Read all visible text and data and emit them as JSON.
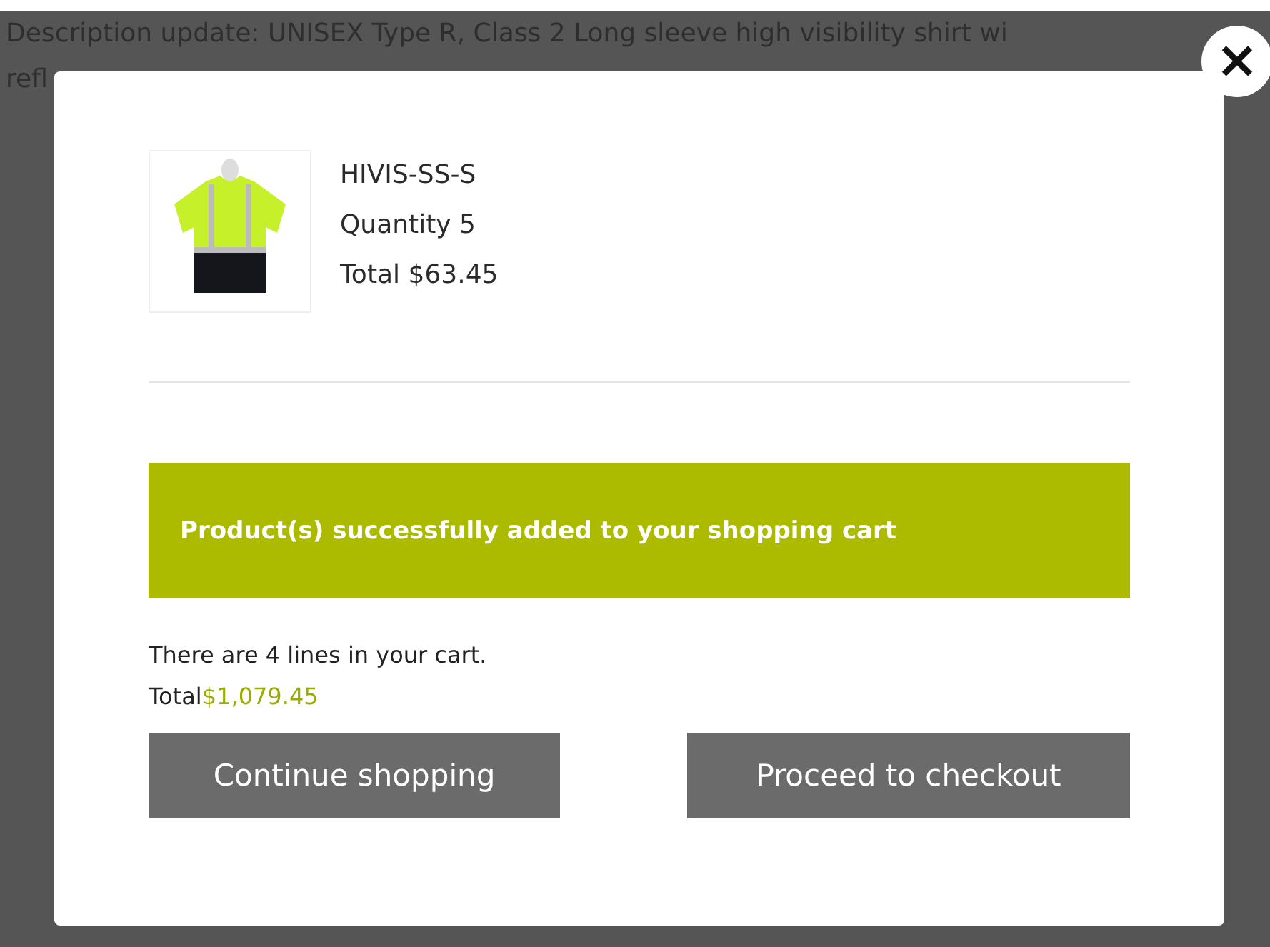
{
  "background_text": [
    "Description update: UNISEX Type R, Class 2 Long sleeve high visibility shirt wi",
    "refl"
  ],
  "modal": {
    "close": "×",
    "product": {
      "sku": "HIVIS-SS-S",
      "quantity": "Quantity 5",
      "total": "Total $63.45"
    },
    "message": "Product(s) successfully added to your shopping cart",
    "cart_lines": "There are 4 lines in your cart.",
    "cart_total_label": "Total",
    "cart_total": "$1,079.45",
    "buttons": [
      "Continue shopping",
      "Proceed to checkout"
    ]
  }
}
